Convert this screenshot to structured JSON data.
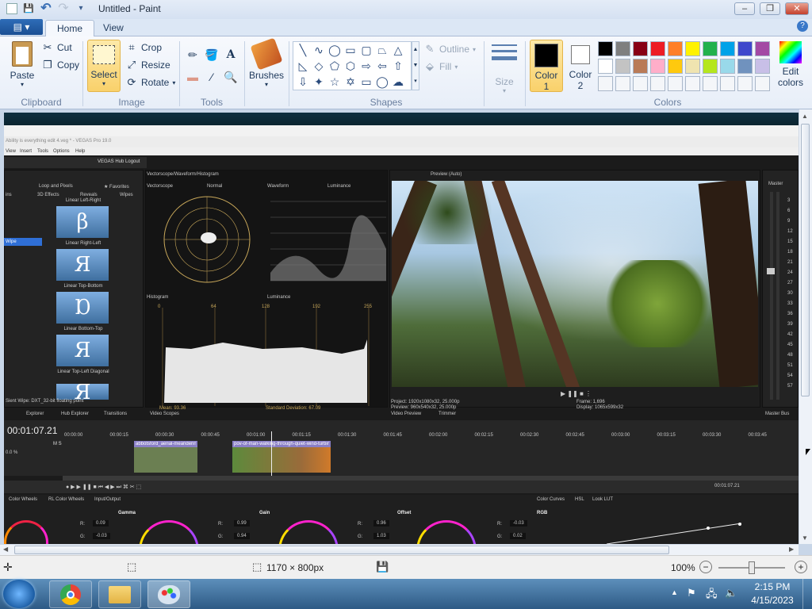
{
  "window": {
    "title": "Untitled - Paint",
    "minimize": "–",
    "restore": "❐",
    "close": "✕"
  },
  "qat": {
    "save": "💾",
    "undo": "↶",
    "redo": "↷",
    "dropdown": "▾"
  },
  "tabs": {
    "file": "▤ ▾",
    "home": "Home",
    "view": "View",
    "help": "?"
  },
  "ribbon": {
    "clipboard": {
      "label": "Clipboard",
      "paste": "Paste",
      "cut": "Cut",
      "copy": "Copy"
    },
    "image": {
      "label": "Image",
      "select": "Select",
      "crop": "Crop",
      "resize": "Resize",
      "rotate": "Rotate"
    },
    "tools": {
      "label": "Tools"
    },
    "brushes": {
      "label": "Brushes"
    },
    "shapes": {
      "label": "Shapes",
      "outline": "Outline",
      "fill": "Fill"
    },
    "size": {
      "label": "Size"
    },
    "colors": {
      "label": "Colors",
      "color1": "Color",
      "color1_num": "1",
      "color2": "Color",
      "color2_num": "2",
      "edit": "Edit",
      "edit2": "colors",
      "palette_row1": [
        "#000000",
        "#7f7f7f",
        "#880015",
        "#ed1c24",
        "#ff7f27",
        "#fff200",
        "#22b14c",
        "#00a2e8",
        "#3f48cc",
        "#a349a4"
      ],
      "palette_row2": [
        "#ffffff",
        "#c3c3c3",
        "#b97a57",
        "#ffaec9",
        "#ffc90e",
        "#efe4b0",
        "#b5e61d",
        "#99d9ea",
        "#7092be",
        "#c8bfe7"
      ]
    }
  },
  "canvas_content": {
    "vegas_title": "Ability is everything edit 4.veg * - VEGAS Pro 19.0",
    "menu": [
      "View",
      "Insert",
      "Tools",
      "Options",
      "Help"
    ],
    "hub_logout": "VEGAS Hub Logout",
    "scopes_header": "Vectorscope/Waveform/Histogram",
    "vectorscope": "Vectorscope",
    "normal": "Normal",
    "waveform": "Waveform",
    "luminance": "Luminance",
    "histogram": "Histogram",
    "histo_luminance": "Luminance",
    "preview_header": "Preview (Auto)",
    "loop_pixels": "Loop and Pixels",
    "favorites": "★ Favorites",
    "fx_tabs": [
      "ins",
      "3D Effects",
      "Reveals",
      "Wipes"
    ],
    "wipe_selected": "Wipe",
    "left_list": [
      "pe",
      "ect",
      "pe",
      "op",
      "p",
      "Blinds",
      "w"
    ],
    "wipes": [
      "Linear Left-Right",
      "Linear Right-Left",
      "Linear Top-Bottom",
      "Linear Bottom-Top",
      "Linear Top-Left Diagonal"
    ],
    "wipe_status": "Sient Wipe: DXT_32-bit floating point",
    "panel_tabs": [
      "Explorer",
      "Hub Explorer",
      "Transitions"
    ],
    "video_scopes_tab": "Video Scopes",
    "histo_ticks": [
      "0",
      "64",
      "128",
      "192",
      "255"
    ],
    "waveform_ticks": [
      "120",
      "100",
      "80",
      "60",
      "40",
      "20",
      "0",
      "-20"
    ],
    "mean": "Mean: 93.36",
    "std_dev": "Standard Deviation: 67.09",
    "project": "Project: 1920x1080x32, 25.000p",
    "preview": "Preview: 960x540x32, 25.000p",
    "frame": "Frame: 1,696",
    "display": "Display: 1065x599x32",
    "video_preview_tab": "Video Preview",
    "trimmer_tab": "Trimmer",
    "master": "Master",
    "master_bus": "Master Bus",
    "meter_ticks": [
      "3",
      "6",
      "9",
      "12",
      "15",
      "18",
      "21",
      "24",
      "27",
      "30",
      "33",
      "36",
      "39",
      "42",
      "45",
      "48",
      "51",
      "54",
      "57"
    ],
    "timecode": "00:01:07.21",
    "track_level": "0.0 %",
    "ruler": [
      "00:00:00",
      "00:00:15",
      "00:00:30",
      "00:00:45",
      "00:01:00",
      "00:01:15",
      "00:01:30",
      "00:01:45",
      "00:02:00",
      "00:02:15",
      "00:02:30",
      "00:02:45",
      "00:03:00",
      "00:03:15",
      "00:03:30",
      "00:03:45"
    ],
    "clip1": "abbotsford_aerial-meandering",
    "clip2": "pov-of-man-walking-through-quiet-wind-turbine-wind",
    "end_time": "00:01:07.21",
    "cc_tabs": [
      "Color Wheels",
      "RL Color Wheels",
      "Input/Output"
    ],
    "cc_tabs_right": [
      "Color Curves",
      "HSL",
      "Look LUT"
    ],
    "gamma": "Gamma",
    "gain": "Gain",
    "offset": "Offset",
    "rgb": "RGB",
    "col1": {
      "r": "0.09",
      "g": "-0.03"
    },
    "gamma_vals": {
      "r": "0.99",
      "g": "0.94"
    },
    "gain_vals": {
      "r": "0.96",
      "g": "1.03"
    },
    "offset_vals": {
      "r": "-0.03",
      "g": "0.02"
    },
    "r": "R:",
    "g": "G:"
  },
  "statusbar": {
    "dimensions": "1170 × 800px",
    "zoom": "100%"
  },
  "taskbar": {
    "time": "2:15 PM",
    "date": "4/15/2023"
  }
}
